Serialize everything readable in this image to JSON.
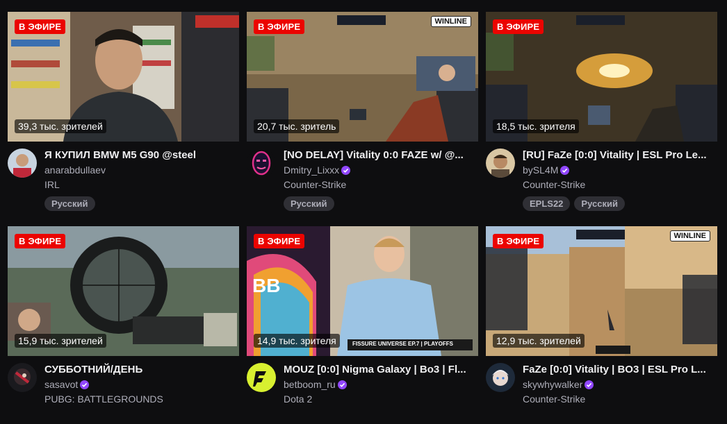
{
  "live_label": "В ЭФИРЕ",
  "streams": [
    {
      "viewers": "39,3 тыс. зрителей",
      "title": "Я КУПИЛ BMW M5 G90 @steel",
      "channel": "anarabdullaev",
      "verified": false,
      "category": "IRL",
      "tags": [
        "Русский"
      ]
    },
    {
      "viewers": "20,7 тыс. зритель",
      "title": "[NO DELAY] Vitality 0:0 FAZE w/ @...",
      "channel": "Dmitry_Lixxx",
      "verified": true,
      "category": "Counter-Strike",
      "tags": [
        "Русский"
      ]
    },
    {
      "viewers": "18,5 тыс. зрителя",
      "title": "[RU] FaZe [0:0] Vitality | ESL Pro Le...",
      "channel": "bySL4M",
      "verified": true,
      "category": "Counter-Strike",
      "tags": [
        "EPLS22",
        "Русский"
      ]
    },
    {
      "viewers": "15,9 тыс. зрителей",
      "title": "СУББОТНИЙ/ДЕНЬ",
      "channel": "sasavot",
      "verified": true,
      "category": "PUBG: BATTLEGROUNDS",
      "tags": []
    },
    {
      "viewers": "14,9 тыс. зрителя",
      "title": "MOUZ [0:0] Nigma Galaxy | Bo3 | Fl...",
      "channel": "betboom_ru",
      "verified": true,
      "category": "Dota 2",
      "tags": []
    },
    {
      "viewers": "12,9 тыс. зрителей",
      "title": "FaZe [0:0] Vitality | BO3 | ESL Pro L...",
      "channel": "skywhywalker",
      "verified": true,
      "category": "Counter-Strike",
      "tags": []
    }
  ],
  "overlays": {
    "winline": "WINLINE",
    "bb_logo": "BB",
    "fissure": "FISSURE UNIVERSE EP.7 | PLAYOFFS"
  }
}
